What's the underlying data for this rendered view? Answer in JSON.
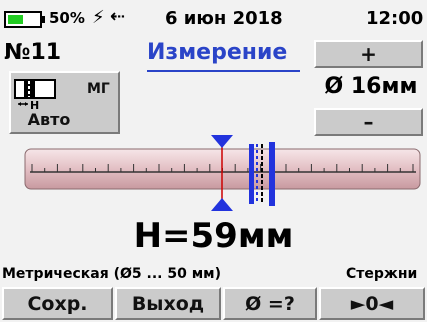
{
  "status_bar": {
    "battery_percent_text": "50%",
    "battery_level": 0.5,
    "battery_color": "#22cc22",
    "charge_icon": "⚡",
    "usb_icon": "⇠",
    "date": "6 июн 2018",
    "time": "12:00"
  },
  "header": {
    "object_number": "№11",
    "title": "Измерение",
    "title_color": "#2a44c8"
  },
  "diameter_panel": {
    "plus_label": "+",
    "value": "Ø 16мм",
    "minus_label": "–"
  },
  "mode_box": {
    "units_label": "МГ",
    "h_label": "Н",
    "mode_label": "Авто"
  },
  "ruler": {
    "band_color": "#e8c8cc",
    "marker_color": "#2233dd",
    "cursor_color": "#cc0000"
  },
  "measurement": {
    "text": "Н=59мм"
  },
  "info": {
    "scale": "Метрическая (Ø5 ... 50 мм)",
    "object_type": "Стержни"
  },
  "softkeys": {
    "save": "Сохр.",
    "exit": "Выход",
    "diameter_query": "Ø =?",
    "zero": "►0◄"
  }
}
